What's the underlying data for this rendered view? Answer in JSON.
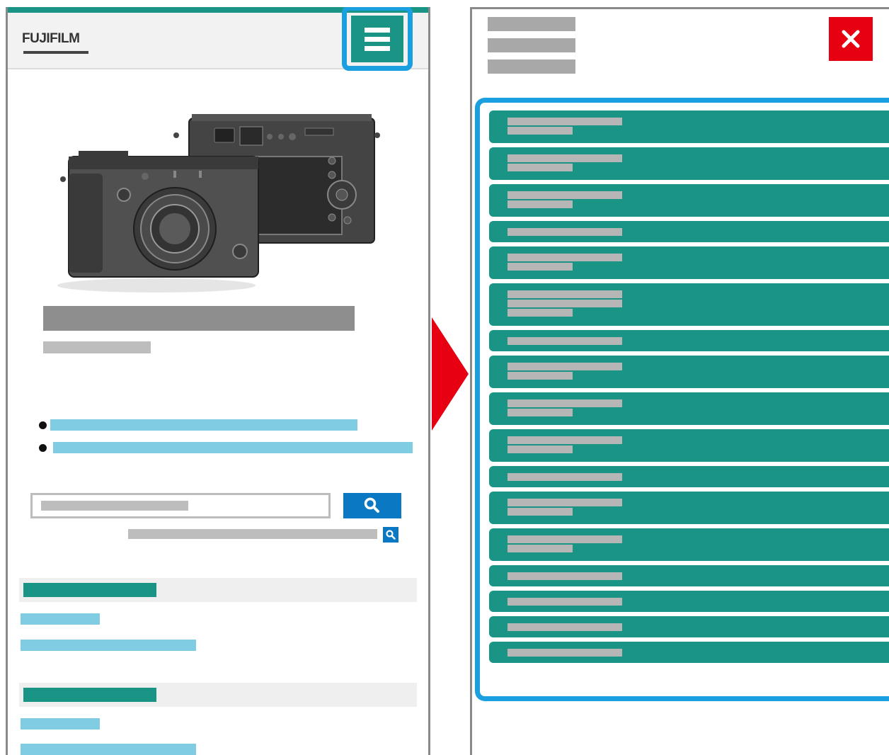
{
  "left_screen": {
    "logo_text": "FUJIFILM",
    "menu_button_icon": "hamburger-menu-icon",
    "search_button_icon": "search-icon",
    "advanced_search_icon": "search-icon"
  },
  "transition_arrow_icon": "arrow-right-icon",
  "right_screen": {
    "close_button_icon": "close-icon",
    "menu_items": [
      {
        "lines": 2
      },
      {
        "lines": 2
      },
      {
        "lines": 2
      },
      {
        "lines": 1
      },
      {
        "lines": 2
      },
      {
        "lines": 3
      },
      {
        "lines": 1
      },
      {
        "lines": 2
      },
      {
        "lines": 2
      },
      {
        "lines": 2
      },
      {
        "lines": 1
      },
      {
        "lines": 2
      },
      {
        "lines": 2
      },
      {
        "lines": 1
      },
      {
        "lines": 1
      },
      {
        "lines": 1
      },
      {
        "lines": 1
      }
    ]
  },
  "colors": {
    "teal": "#1a9585",
    "highlight_blue": "#1aa0e0",
    "search_blue": "#0a78c2",
    "close_red": "#e60012",
    "arrow_red": "#e60012",
    "link_blue": "#80cce2",
    "placeholder_gray": "#bdbdbd"
  }
}
